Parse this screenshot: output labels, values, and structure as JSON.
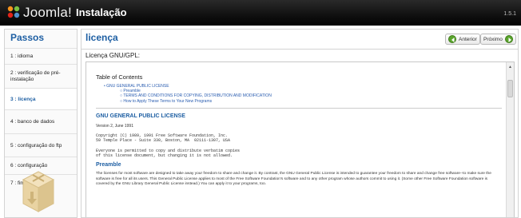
{
  "header": {
    "brand": "Joomla!",
    "title": "Instalação",
    "version": "1.5.1"
  },
  "sidebar": {
    "title": "Passos",
    "steps": [
      {
        "label": "1 : idioma"
      },
      {
        "label": "2 : verificação de pré-instalação"
      },
      {
        "label": "3 : licença"
      },
      {
        "label": "4 : banco de dados"
      },
      {
        "label": "5 : configuração do ftp"
      },
      {
        "label": "6 : configuração"
      },
      {
        "label": "7 : fim"
      }
    ],
    "active_step": 2
  },
  "main": {
    "title": "licença",
    "prev_label": "Anterior",
    "next_label": "Próximo",
    "license_heading": "Licença GNU/GPL:"
  },
  "license": {
    "toc_title": "Table of Contents",
    "toc_level1": "GNU GENERAL PUBLIC LICENSE",
    "toc_level2": [
      "Preamble",
      "TERMS AND CONDITIONS FOR COPYING, DISTRIBUTION AND MODIFICATION",
      "How to Apply These Terms to Your New Programs"
    ],
    "gnu_title": "GNU GENERAL PUBLIC LICENSE",
    "version_line": "Version 2, June 1991",
    "copyright": "Copyright (C) 1989, 1991 Free Software Foundation, Inc.\n59 Temple Place - Suite 330, Boston, MA  02111-1307, USA",
    "permission": "Everyone is permitted to copy and distribute verbatim copies\nof this license document, but changing it is not allowed.",
    "preamble_title": "Preamble",
    "preamble_text": "The licenses for most software are designed to take away your freedom to share and change it. By contrast, the GNU General Public License is intended to guarantee your freedom to share and change free software--to make sure the software is free for all its users. This General Public License applies to most of the Free Software Foundation's software and to any other program whose authors commit to using it. (Some other Free Software Foundation software is covered by the GNU Library General Public License instead.) You can apply it to your programs, too."
  },
  "colors": {
    "accent": "#1e5fa3",
    "header_bg": "#0d0d0d",
    "button_green": "#5aa52c"
  }
}
